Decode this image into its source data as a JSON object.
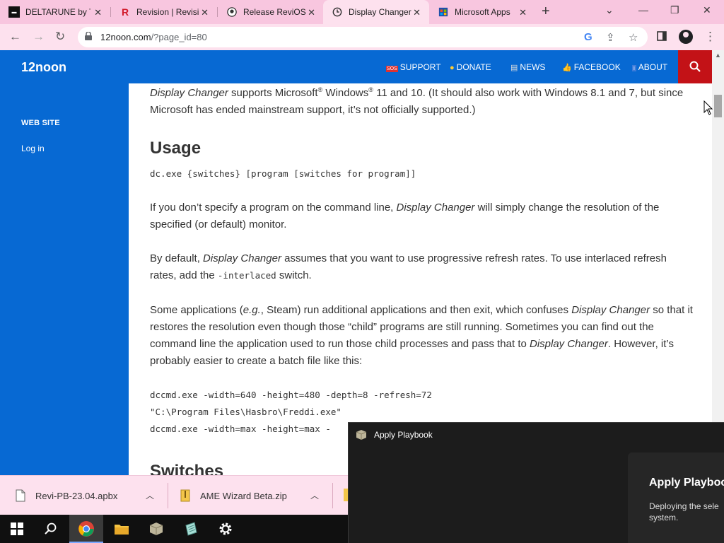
{
  "browser": {
    "tabs": [
      {
        "title": "DELTARUNE by Tob",
        "favicon": "deltarune-icon",
        "active": false
      },
      {
        "title": "Revision | Revisi",
        "favicon": "revision-icon",
        "active": false
      },
      {
        "title": "Release ReviOS Pl",
        "favicon": "github-icon",
        "active": false
      },
      {
        "title": "Display Changer",
        "favicon": "clock-icon",
        "active": true
      },
      {
        "title": "Microsoft Apps",
        "favicon": "microsoft-store-icon",
        "active": false
      }
    ],
    "address": {
      "host": "12noon.com",
      "path": "/?page_id=80"
    }
  },
  "site": {
    "title": "12noon",
    "nav": [
      {
        "emoji": "🆘",
        "label": "SUPPORT"
      },
      {
        "emoji": "😎",
        "label": "DONATE"
      },
      {
        "emoji": "📄",
        "label": "NEWS"
      },
      {
        "emoji": "👍",
        "label": "FACEBOOK"
      },
      {
        "emoji": "ℹ",
        "label": "ABOUT"
      }
    ],
    "sidebar": {
      "heading": "WEB SITE",
      "link": "Log in"
    }
  },
  "article": {
    "intro": {
      "t1": "Display Changer",
      "t2": " supports Microsoft",
      "sup1": "®",
      "t3": " Windows",
      "sup2": "®",
      "t4": " 11 and 10. (It should also work with Windows 8.1 and 7, but since Microsoft has ended mainstream support, it’s not officially supported.)"
    },
    "usage_heading": "Usage",
    "usage_code": "dc.exe {switches} [program [switches for program]]",
    "p1": {
      "a": "If you don’t specify a program on the command line, ",
      "b": "Display Changer",
      "c": " will simply change the resolution of the specified (or default) monitor."
    },
    "p2": {
      "a": "By default, ",
      "b": "Display Changer",
      "c": " assumes that you want to use progressive refresh rates. To use interlaced refresh rates, add the ",
      "code": "-interlaced",
      "d": " switch."
    },
    "p3": {
      "a": "Some applications (",
      "eg": "e.g.",
      "b": ", Steam) run additional applications and then exit, which confuses ",
      "c": "Display Changer",
      "d": " so that it restores the resolution even though those “child” programs are still running. Sometimes you can find out the command line the application used to run those child processes and pass that to ",
      "e": "Display Changer",
      "f": ". However, it’s probably easier to create a batch file like this:"
    },
    "batch": [
      "dccmd.exe -width=640 -height=480 -depth=8 -refresh=72",
      "\"C:\\Program Files\\Hasbro\\Freddi.exe\"",
      "dccmd.exe -width=max -height=max -"
    ],
    "switches_heading": "Switches"
  },
  "downloads": [
    {
      "name": "Revi-PB-23.04.apbx",
      "icon": "file-icon"
    },
    {
      "name": "AME Wizard Beta.zip",
      "icon": "zip-icon"
    }
  ],
  "taskbar": [
    "windows-start-icon",
    "search-icon",
    "chrome-icon",
    "file-explorer-icon",
    "package-icon",
    "notepad-icon",
    "settings-icon"
  ],
  "apply_playbook": {
    "title": "Apply Playbook",
    "heading": "Apply Playboo",
    "body": "Deploying the sele system."
  },
  "colors": {
    "site_blue": "#0769d3",
    "search_red": "#c31217",
    "tab_pink": "#f8c6df"
  }
}
